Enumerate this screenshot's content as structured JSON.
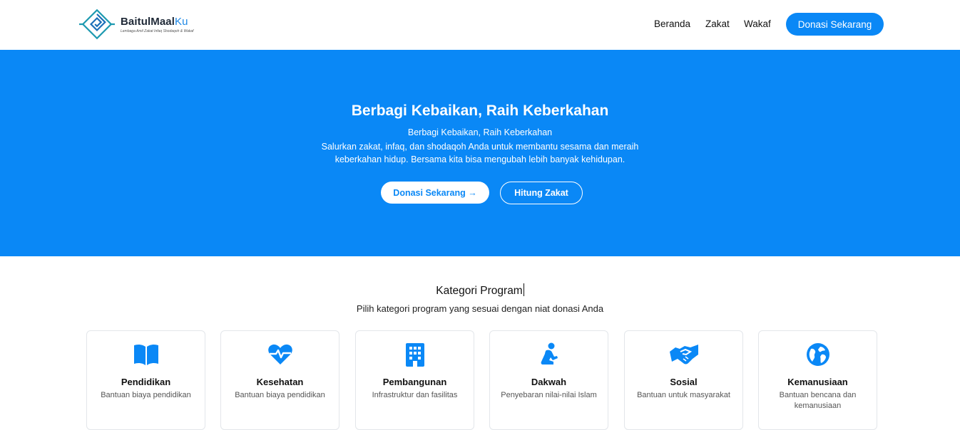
{
  "brand": {
    "name_main": "BaitulMaal",
    "name_accent": "Ku",
    "tagline": "Lembaga Amil Zakat Infaq Shodaqoh & Wakaf"
  },
  "nav": {
    "items": [
      "Beranda",
      "Zakat",
      "Wakaf"
    ],
    "cta": "Donasi Sekarang"
  },
  "hero": {
    "title": "Berbagi Kebaikan, Raih Keberkahan",
    "subtitle": "Berbagi Kebaikan, Raih Keberkahan",
    "description": "Salurkan zakat, infaq, dan shodaqoh Anda untuk membantu sesama dan meraih keberkahan hidup. Bersama kita bisa mengubah lebih banyak kehidupan.",
    "primary_button": "Donasi Sekarang →",
    "secondary_button": "Hitung Zakat"
  },
  "categories": {
    "title": "Kategori Program",
    "subtitle": "Pilih kategori program yang sesuai dengan niat donasi Anda",
    "items": [
      {
        "title": "Pendidikan",
        "desc": "Bantuan biaya pendidikan",
        "icon": "book-icon"
      },
      {
        "title": "Kesehatan",
        "desc": "Bantuan biaya pendidikan",
        "icon": "heart-pulse-icon"
      },
      {
        "title": "Pembangunan",
        "desc": "Infrastruktur dan fasilitas",
        "icon": "building-icon"
      },
      {
        "title": "Dakwah",
        "desc": "Penyebaran nilai-nilai Islam",
        "icon": "praying-person-icon"
      },
      {
        "title": "Sosial",
        "desc": "Bantuan untuk masyarakat",
        "icon": "handshake-icon"
      },
      {
        "title": "Kemanusiaan",
        "desc": "Bantuan bencana dan kemanusiaan",
        "icon": "globe-icon"
      }
    ]
  },
  "colors": {
    "primary": "#0a88f6",
    "logo_teal": "#1e9ab0"
  }
}
